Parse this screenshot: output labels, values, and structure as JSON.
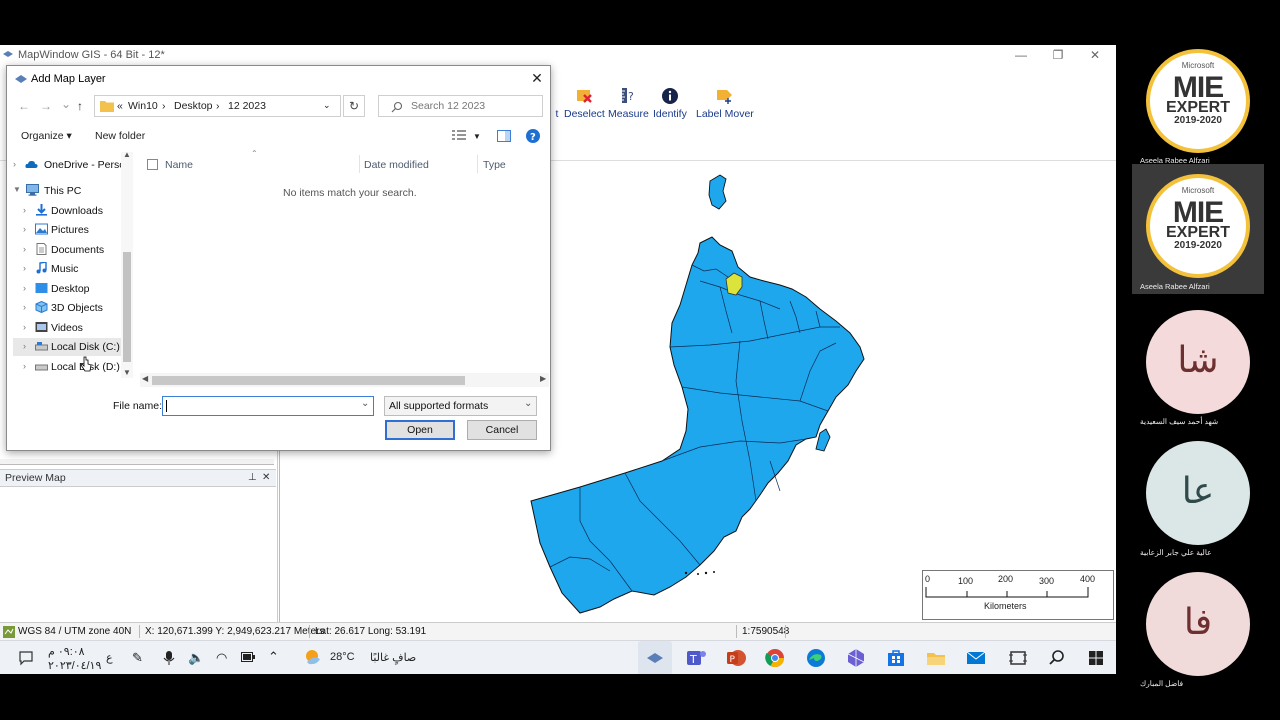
{
  "app": {
    "title": "MapWindow GIS - 64 Bit - 12*",
    "minimize": "—",
    "restore": "❐",
    "close": "✕"
  },
  "toolbar": {
    "items": [
      {
        "label": "t",
        "icon": "partial-tool-icon"
      },
      {
        "label": "Deselect",
        "icon": "deselect-icon"
      },
      {
        "label": "Measure",
        "icon": "measure-icon"
      },
      {
        "label": "Identify",
        "icon": "identify-icon"
      },
      {
        "label": "Label Mover",
        "icon": "label-mover-icon"
      }
    ]
  },
  "preview_map": {
    "title": "Preview Map",
    "pin": "📌",
    "close": "✕"
  },
  "dialog": {
    "title": "Add Map Layer",
    "close": "✕",
    "nav": {
      "back": "←",
      "forward": "→",
      "recent": "⌄",
      "up": "↑"
    },
    "breadcrumb": [
      "«",
      "Win10",
      "›",
      "Desktop",
      "›",
      "12 2023"
    ],
    "refresh": "↻",
    "search_placeholder": "Search 12 2023",
    "commands": {
      "organize": "Organize ▾",
      "new_folder": "New folder"
    },
    "nav_items": [
      {
        "label": "OneDrive - Persor",
        "icon": "cloud-icon",
        "expanded": false
      },
      {
        "label": "This PC",
        "icon": "computer-icon",
        "expanded": true
      },
      {
        "label": "Downloads",
        "icon": "download-folder-icon",
        "expanded": false
      },
      {
        "label": "Pictures",
        "icon": "pictures-folder-icon",
        "expanded": false
      },
      {
        "label": "Documents",
        "icon": "documents-folder-icon",
        "expanded": false
      },
      {
        "label": "Music",
        "icon": "music-folder-icon",
        "expanded": false
      },
      {
        "label": "Desktop",
        "icon": "desktop-folder-icon",
        "expanded": false
      },
      {
        "label": "3D Objects",
        "icon": "3d-objects-icon",
        "expanded": false
      },
      {
        "label": "Videos",
        "icon": "videos-folder-icon",
        "expanded": false
      },
      {
        "label": "Local Disk (C:)",
        "icon": "drive-icon",
        "expanded": false
      },
      {
        "label": "Local Disk (D:)",
        "icon": "drive-icon",
        "expanded": false
      }
    ],
    "columns": {
      "name": "Name",
      "date_modified": "Date modified",
      "type": "Type"
    },
    "empty_message": "No items match your search.",
    "file_name_label": "File name:",
    "file_name_value": "",
    "filter": "All supported formats",
    "open_button": "Open",
    "cancel_button": "Cancel"
  },
  "scale_bar": {
    "ticks": [
      "0",
      "100",
      "200",
      "300",
      "400"
    ],
    "unit": "Kilometers"
  },
  "status": {
    "projection": "WGS 84 / UTM zone 40N",
    "coords": "X: 120,671.399 Y: 2,949,623.217 Meters",
    "latlong": "Lat: 26.617 Long: 53.191",
    "scale": "1:7590548"
  },
  "taskbar": {
    "time": "٠٩:٠٨ م",
    "date": "٢٠٢٣/٠٤/١٩",
    "lang": "ع",
    "weather_temp": "28°C",
    "weather_desc": "صافٍ غالبًا",
    "apps": [
      "mapwindow-icon",
      "teams-icon",
      "powerpoint-icon",
      "chrome-icon",
      "edge-icon",
      "3d-app-icon",
      "store-icon",
      "file-explorer-icon",
      "mail-icon",
      "snip-icon",
      "search-icon",
      "start-icon"
    ]
  },
  "participants": [
    {
      "name": "Aseela Rabee Alfzari",
      "badge": {
        "brand": "Microsoft",
        "line1": "MIE",
        "line2": "EXPERT",
        "line3": "2019-2020"
      },
      "active": false
    },
    {
      "name": "Aseela Rabee Alfzari",
      "badge": {
        "brand": "Microsoft",
        "line1": "MIE",
        "line2": "EXPERT",
        "line3": "2019-2020"
      },
      "active": true
    },
    {
      "name": "شهد أحمد سيف السعيدية",
      "initials": "شا",
      "color": "#f4dada"
    },
    {
      "name": "عالية علي جابر الزعابية",
      "initials": "عا",
      "color": "#dbe6e6"
    },
    {
      "name": "فاضل المبارك",
      "initials": "فا",
      "color": "#f0dada"
    }
  ],
  "colors": {
    "map_fill": "#1ea7ec",
    "map_highlight": "#dce33a",
    "accent": "#2f6fd3",
    "badge_gold": "#f3c13a"
  }
}
